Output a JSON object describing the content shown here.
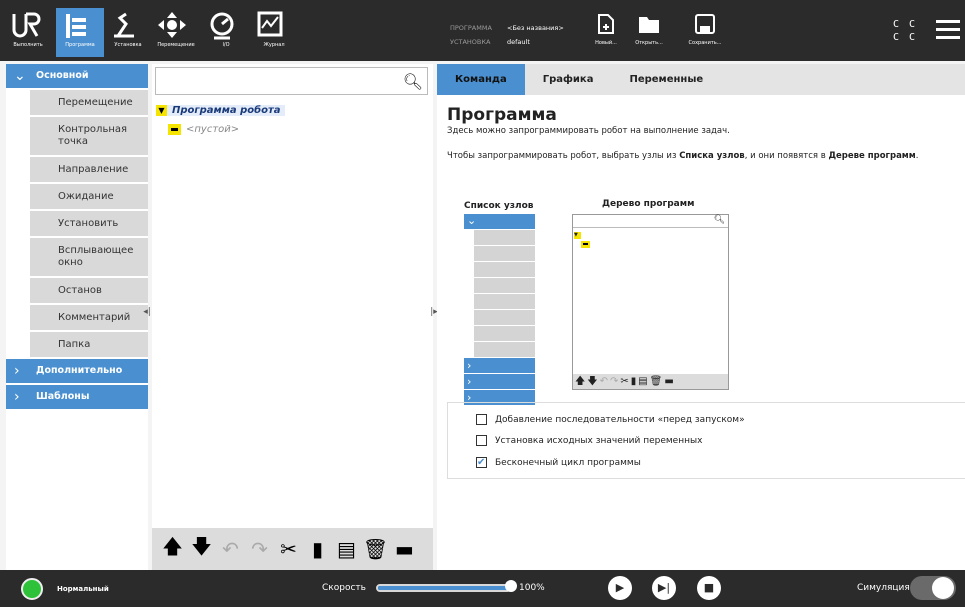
{
  "topbar": {
    "run": "Выполнить",
    "program": "Программа",
    "install": "Установка",
    "move": "Перемещение",
    "io": "I/O",
    "log": "Журнал",
    "program_key": "ПРОГРАММА",
    "program_val": "<Без названия>",
    "install_key": "УСТАНОВКА",
    "install_val": "default",
    "new": "Новый...",
    "open": "Открыть...",
    "save": "Сохранить...",
    "cc1": "C C",
    "cc2": "C C"
  },
  "left": {
    "basic": "Основной",
    "nodes": [
      "Перемещение",
      "Контрольная точка",
      "Направление",
      "Ожидание",
      "Установить",
      "Всплывающее окно",
      "Останов",
      "Комментарий",
      "Папка"
    ],
    "advanced": "Дополнительно",
    "templates": "Шаблоны"
  },
  "tree": {
    "root": "Программа робота",
    "empty": "<пустой>"
  },
  "tabs": [
    "Команда",
    "Графика",
    "Переменные"
  ],
  "right": {
    "title": "Программа",
    "desc": "Здесь можно запрограммировать робот на выполнение задач.",
    "instr_pre": "Чтобы запрограммировать робот, выбрать узлы из ",
    "instr_b1": "Списка узлов",
    "instr_mid": ", и они появятся в ",
    "instr_b2": "Дереве программ",
    "instr_end": ".",
    "nodelist_title": "Список узлов",
    "tree_title": "Дерево программ",
    "checks": [
      {
        "label": "Добавление последовательности «перед запуском»",
        "checked": false
      },
      {
        "label": "Установка исходных значений переменных",
        "checked": false
      },
      {
        "label": "Бесконечный цикл программы",
        "checked": true
      }
    ]
  },
  "bottom": {
    "status": "Нормальный",
    "speed_label": "Скорость",
    "speed_value": "100%",
    "speed_pct": 100,
    "sim_label": "Симуляция"
  },
  "colors": {
    "accent": "#4a90d0",
    "bar": "#2b2b2b",
    "status": "#2ec23a",
    "node_yellow": "#f5e400"
  }
}
